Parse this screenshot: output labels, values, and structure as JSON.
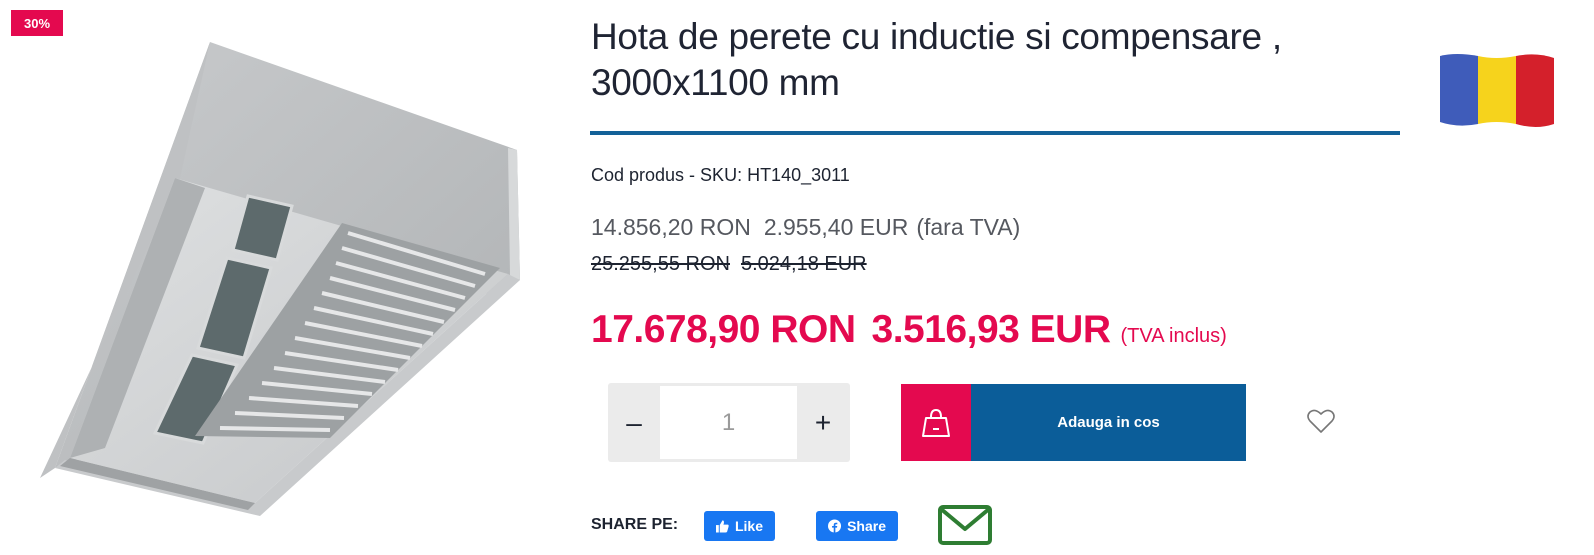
{
  "badge": {
    "discount": "30%"
  },
  "product": {
    "title": "Hota de perete cu inductie si compensare , 3000x1100 mm",
    "sku_label": "Cod produs - SKU: HT140_3011",
    "image_icon": "stainless-steel-wall-hood-image",
    "flag_icon": "romania-flag-icon"
  },
  "prices": {
    "net_ron": "14.856,20 RON",
    "net_eur": "2.955,40 EUR",
    "net_note": "(fara TVA)",
    "old_ron": "25.255,55 RON",
    "old_eur": "5.024,18 EUR",
    "final_ron": "17.678,90 RON",
    "final_eur": "3.516,93 EUR",
    "final_note": "(TVA inclus)"
  },
  "quantity": {
    "minus": "–",
    "value": "1",
    "plus": "+"
  },
  "cart": {
    "label": "Adauga in cos",
    "icon": "shopping-bag-icon"
  },
  "wishlist": {
    "icon": "heart-icon"
  },
  "share": {
    "label": "SHARE PE:",
    "like_label": "Like",
    "share_label": "Share",
    "email_icon": "envelope-icon"
  },
  "colors": {
    "accent": "#e4094f",
    "primary": "#0b5d99",
    "rule": "#136198",
    "facebook": "#1877f2",
    "email": "#2e7d32"
  }
}
